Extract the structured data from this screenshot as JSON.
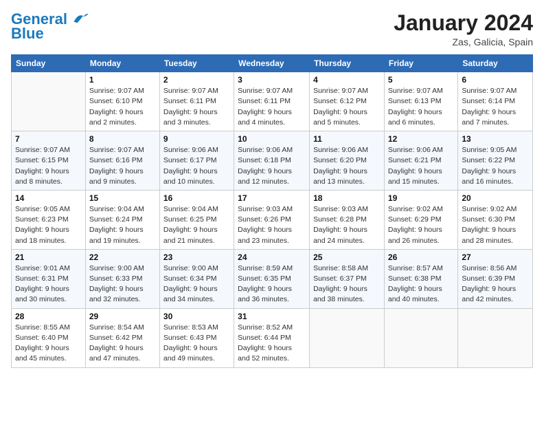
{
  "header": {
    "logo_line1": "General",
    "logo_line2": "Blue",
    "month_year": "January 2024",
    "location": "Zas, Galicia, Spain"
  },
  "days_of_week": [
    "Sunday",
    "Monday",
    "Tuesday",
    "Wednesday",
    "Thursday",
    "Friday",
    "Saturday"
  ],
  "weeks": [
    [
      {
        "day": "",
        "sunrise": "",
        "sunset": "",
        "daylight": ""
      },
      {
        "day": "1",
        "sunrise": "Sunrise: 9:07 AM",
        "sunset": "Sunset: 6:10 PM",
        "daylight": "Daylight: 9 hours and 2 minutes."
      },
      {
        "day": "2",
        "sunrise": "Sunrise: 9:07 AM",
        "sunset": "Sunset: 6:11 PM",
        "daylight": "Daylight: 9 hours and 3 minutes."
      },
      {
        "day": "3",
        "sunrise": "Sunrise: 9:07 AM",
        "sunset": "Sunset: 6:11 PM",
        "daylight": "Daylight: 9 hours and 4 minutes."
      },
      {
        "day": "4",
        "sunrise": "Sunrise: 9:07 AM",
        "sunset": "Sunset: 6:12 PM",
        "daylight": "Daylight: 9 hours and 5 minutes."
      },
      {
        "day": "5",
        "sunrise": "Sunrise: 9:07 AM",
        "sunset": "Sunset: 6:13 PM",
        "daylight": "Daylight: 9 hours and 6 minutes."
      },
      {
        "day": "6",
        "sunrise": "Sunrise: 9:07 AM",
        "sunset": "Sunset: 6:14 PM",
        "daylight": "Daylight: 9 hours and 7 minutes."
      }
    ],
    [
      {
        "day": "7",
        "sunrise": "Sunrise: 9:07 AM",
        "sunset": "Sunset: 6:15 PM",
        "daylight": "Daylight: 9 hours and 8 minutes."
      },
      {
        "day": "8",
        "sunrise": "Sunrise: 9:07 AM",
        "sunset": "Sunset: 6:16 PM",
        "daylight": "Daylight: 9 hours and 9 minutes."
      },
      {
        "day": "9",
        "sunrise": "Sunrise: 9:06 AM",
        "sunset": "Sunset: 6:17 PM",
        "daylight": "Daylight: 9 hours and 10 minutes."
      },
      {
        "day": "10",
        "sunrise": "Sunrise: 9:06 AM",
        "sunset": "Sunset: 6:18 PM",
        "daylight": "Daylight: 9 hours and 12 minutes."
      },
      {
        "day": "11",
        "sunrise": "Sunrise: 9:06 AM",
        "sunset": "Sunset: 6:20 PM",
        "daylight": "Daylight: 9 hours and 13 minutes."
      },
      {
        "day": "12",
        "sunrise": "Sunrise: 9:06 AM",
        "sunset": "Sunset: 6:21 PM",
        "daylight": "Daylight: 9 hours and 15 minutes."
      },
      {
        "day": "13",
        "sunrise": "Sunrise: 9:05 AM",
        "sunset": "Sunset: 6:22 PM",
        "daylight": "Daylight: 9 hours and 16 minutes."
      }
    ],
    [
      {
        "day": "14",
        "sunrise": "Sunrise: 9:05 AM",
        "sunset": "Sunset: 6:23 PM",
        "daylight": "Daylight: 9 hours and 18 minutes."
      },
      {
        "day": "15",
        "sunrise": "Sunrise: 9:04 AM",
        "sunset": "Sunset: 6:24 PM",
        "daylight": "Daylight: 9 hours and 19 minutes."
      },
      {
        "day": "16",
        "sunrise": "Sunrise: 9:04 AM",
        "sunset": "Sunset: 6:25 PM",
        "daylight": "Daylight: 9 hours and 21 minutes."
      },
      {
        "day": "17",
        "sunrise": "Sunrise: 9:03 AM",
        "sunset": "Sunset: 6:26 PM",
        "daylight": "Daylight: 9 hours and 23 minutes."
      },
      {
        "day": "18",
        "sunrise": "Sunrise: 9:03 AM",
        "sunset": "Sunset: 6:28 PM",
        "daylight": "Daylight: 9 hours and 24 minutes."
      },
      {
        "day": "19",
        "sunrise": "Sunrise: 9:02 AM",
        "sunset": "Sunset: 6:29 PM",
        "daylight": "Daylight: 9 hours and 26 minutes."
      },
      {
        "day": "20",
        "sunrise": "Sunrise: 9:02 AM",
        "sunset": "Sunset: 6:30 PM",
        "daylight": "Daylight: 9 hours and 28 minutes."
      }
    ],
    [
      {
        "day": "21",
        "sunrise": "Sunrise: 9:01 AM",
        "sunset": "Sunset: 6:31 PM",
        "daylight": "Daylight: 9 hours and 30 minutes."
      },
      {
        "day": "22",
        "sunrise": "Sunrise: 9:00 AM",
        "sunset": "Sunset: 6:33 PM",
        "daylight": "Daylight: 9 hours and 32 minutes."
      },
      {
        "day": "23",
        "sunrise": "Sunrise: 9:00 AM",
        "sunset": "Sunset: 6:34 PM",
        "daylight": "Daylight: 9 hours and 34 minutes."
      },
      {
        "day": "24",
        "sunrise": "Sunrise: 8:59 AM",
        "sunset": "Sunset: 6:35 PM",
        "daylight": "Daylight: 9 hours and 36 minutes."
      },
      {
        "day": "25",
        "sunrise": "Sunrise: 8:58 AM",
        "sunset": "Sunset: 6:37 PM",
        "daylight": "Daylight: 9 hours and 38 minutes."
      },
      {
        "day": "26",
        "sunrise": "Sunrise: 8:57 AM",
        "sunset": "Sunset: 6:38 PM",
        "daylight": "Daylight: 9 hours and 40 minutes."
      },
      {
        "day": "27",
        "sunrise": "Sunrise: 8:56 AM",
        "sunset": "Sunset: 6:39 PM",
        "daylight": "Daylight: 9 hours and 42 minutes."
      }
    ],
    [
      {
        "day": "28",
        "sunrise": "Sunrise: 8:55 AM",
        "sunset": "Sunset: 6:40 PM",
        "daylight": "Daylight: 9 hours and 45 minutes."
      },
      {
        "day": "29",
        "sunrise": "Sunrise: 8:54 AM",
        "sunset": "Sunset: 6:42 PM",
        "daylight": "Daylight: 9 hours and 47 minutes."
      },
      {
        "day": "30",
        "sunrise": "Sunrise: 8:53 AM",
        "sunset": "Sunset: 6:43 PM",
        "daylight": "Daylight: 9 hours and 49 minutes."
      },
      {
        "day": "31",
        "sunrise": "Sunrise: 8:52 AM",
        "sunset": "Sunset: 6:44 PM",
        "daylight": "Daylight: 9 hours and 52 minutes."
      },
      {
        "day": "",
        "sunrise": "",
        "sunset": "",
        "daylight": ""
      },
      {
        "day": "",
        "sunrise": "",
        "sunset": "",
        "daylight": ""
      },
      {
        "day": "",
        "sunrise": "",
        "sunset": "",
        "daylight": ""
      }
    ]
  ]
}
